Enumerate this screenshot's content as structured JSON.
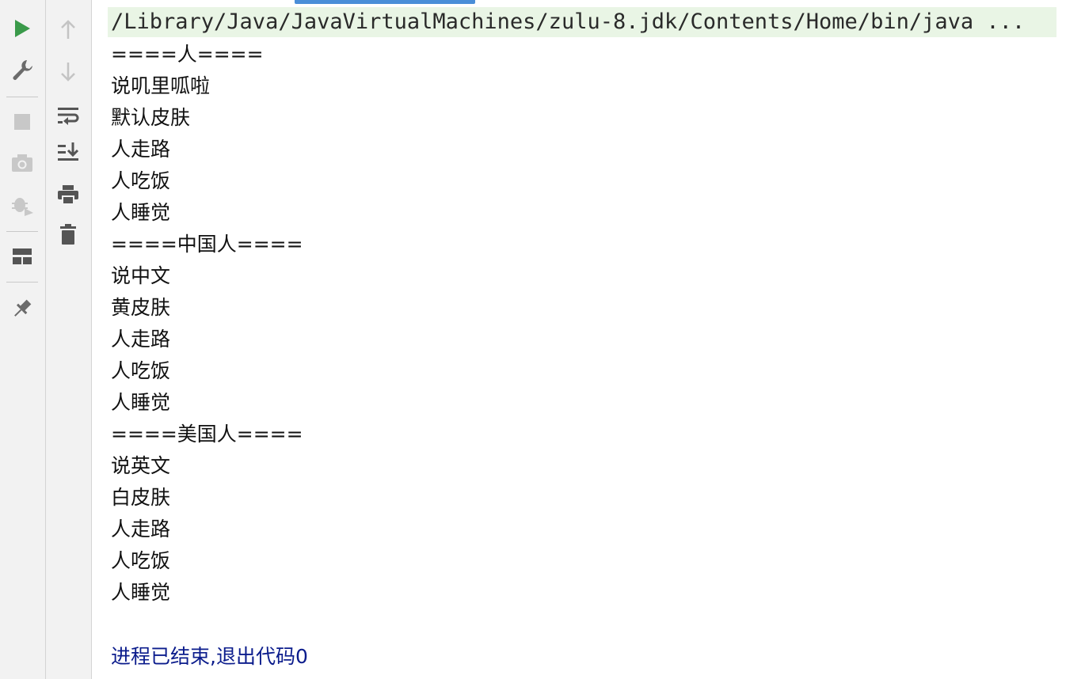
{
  "left_toolbar": {
    "buttons": [
      {
        "name": "run-icon",
        "color": "#3a9a4a"
      },
      {
        "name": "wrench-icon"
      },
      {
        "name": "stop-icon"
      },
      {
        "name": "camera-icon"
      },
      {
        "name": "debug-icon"
      },
      {
        "name": "layout-icon"
      },
      {
        "name": "pin-icon"
      }
    ]
  },
  "right_toolbar": {
    "buttons": [
      {
        "name": "arrow-up-icon"
      },
      {
        "name": "arrow-down-icon"
      },
      {
        "name": "soft-wrap-icon"
      },
      {
        "name": "scroll-to-end-icon"
      },
      {
        "name": "print-icon"
      },
      {
        "name": "trash-icon"
      }
    ]
  },
  "console": {
    "command": "/Library/Java/JavaVirtualMachines/zulu-8.jdk/Contents/Home/bin/java ...",
    "lines": [
      "====人====",
      "说叽里呱啦",
      "默认皮肤",
      "人走路",
      "人吃饭",
      "人睡觉",
      "====中国人====",
      "说中文",
      "黄皮肤",
      "人走路",
      "人吃饭",
      "人睡觉",
      "====美国人====",
      "说英文",
      "白皮肤",
      "人走路",
      "人吃饭",
      "人睡觉"
    ],
    "exit_message": "进程已结束,退出代码0"
  },
  "colors": {
    "command_bg": "#e9f5e5",
    "exit_text": "#0b1c8c",
    "accent": "#4a8ed8"
  }
}
